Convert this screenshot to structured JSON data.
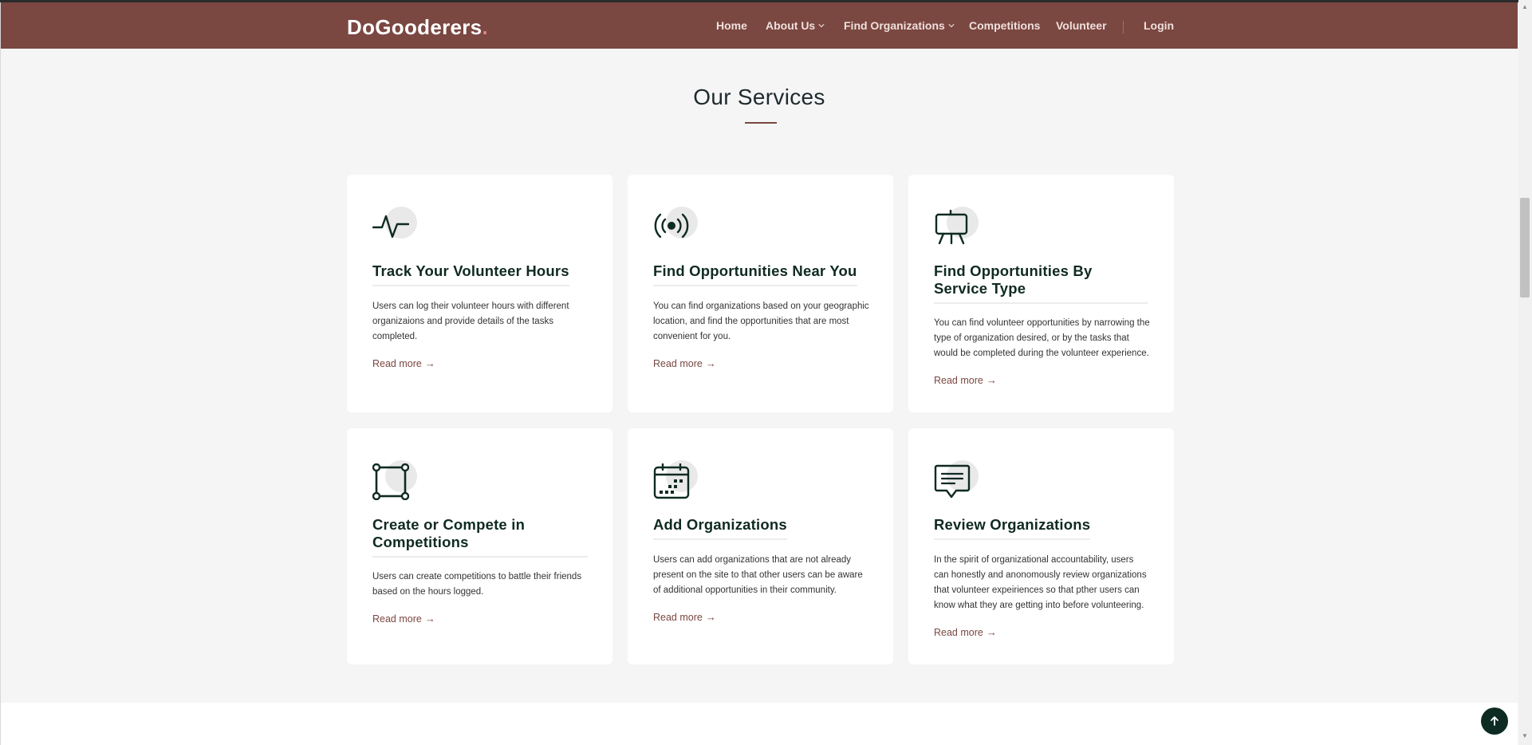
{
  "header": {
    "logo": "DoGooderers",
    "logo_dot": ".",
    "nav": {
      "home": "Home",
      "about": "About Us",
      "find": "Find Organizations",
      "competitions": "Competitions",
      "volunteer": "Volunteer",
      "login": "Login"
    }
  },
  "services": {
    "title": "Our Services",
    "read_more": "Read more",
    "cards": [
      {
        "icon": "activity-icon",
        "title": "Track Your Volunteer Hours",
        "text": "Users can log their volunteer hours with different organizaions and provide details of the tasks completed."
      },
      {
        "icon": "broadcast-icon",
        "title": "Find Opportunities Near You",
        "text": "You can find organizations based on your geographic location, and find the opportunities that are most convenient for you."
      },
      {
        "icon": "easel-icon",
        "title": "Find Opportunities By Service Type",
        "text": "You can find volunteer opportunities by narrowing the type of organization desired, or by the tasks that would be completed during the volunteer experience."
      },
      {
        "icon": "bounding-box-icon",
        "title": "Create or Compete in Competitions",
        "text": "Users can create competitions to battle their friends based on the hours logged."
      },
      {
        "icon": "calendar-icon",
        "title": "Add Organizations",
        "text": "Users can add organizations that are not already present on the site to that other users can be aware of additional opportunities in their community."
      },
      {
        "icon": "chat-icon",
        "title": "Review Organizations",
        "text": "In the spirit of organizational accountability, users can honestly and anonomously review organizations that volunteer expeiriences so that pther users can know what they are getting into before volunteering."
      }
    ]
  },
  "colors": {
    "header_bg": "#7a4741",
    "accent": "#7a4741",
    "title_dark": "#0f2a22",
    "back_to_top": "#0d2b22"
  }
}
